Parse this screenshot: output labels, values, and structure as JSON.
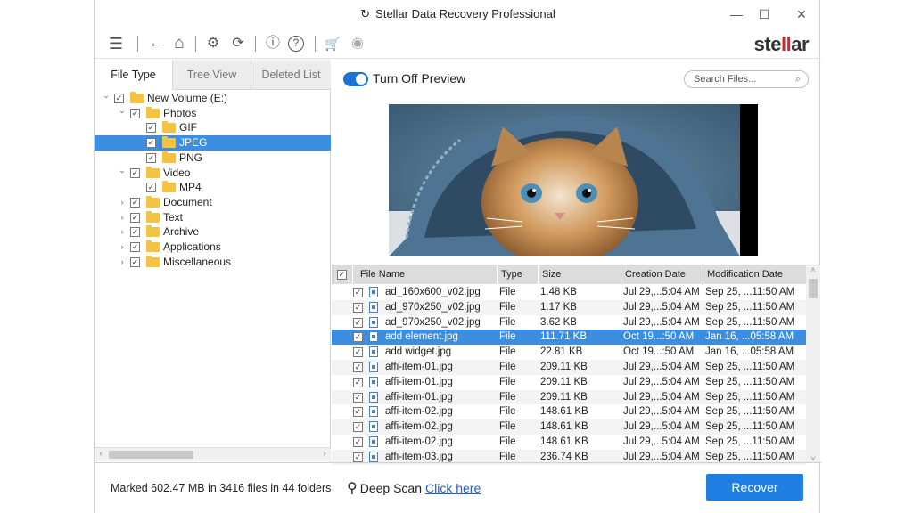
{
  "window": {
    "title": "Stellar Data Recovery Professional",
    "minimize": "—",
    "maximize": "☐",
    "close": "✕"
  },
  "toolbar": {
    "menu_icon": "☰",
    "back_icon": "←",
    "home_icon": "⌂",
    "settings_icon": "⚙",
    "resume_icon": "⟳",
    "info_icon": "ⓘ",
    "help_icon": "?",
    "cart_icon": "🛒",
    "user_icon": "◉",
    "logo_pre": "ste",
    "logo_accent": "ll",
    "logo_post": "ar"
  },
  "tabs": [
    "File Type",
    "Tree View",
    "Deleted List"
  ],
  "tree": [
    {
      "label": "New Volume (E:)",
      "level": 0,
      "arrow": "⌄",
      "selected": false
    },
    {
      "label": "Photos",
      "level": 1,
      "arrow": "⌄",
      "selected": false
    },
    {
      "label": "GIF",
      "level": 2,
      "arrow": "",
      "selected": false
    },
    {
      "label": "JPEG",
      "level": 2,
      "arrow": "",
      "selected": true
    },
    {
      "label": "PNG",
      "level": 2,
      "arrow": "",
      "selected": false
    },
    {
      "label": "Video",
      "level": 1,
      "arrow": "⌄",
      "selected": false
    },
    {
      "label": "MP4",
      "level": 2,
      "arrow": "",
      "selected": false
    },
    {
      "label": "Document",
      "level": 1,
      "arrow": "›",
      "selected": false
    },
    {
      "label": "Text",
      "level": 1,
      "arrow": "›",
      "selected": false
    },
    {
      "label": "Archive",
      "level": 1,
      "arrow": "›",
      "selected": false
    },
    {
      "label": "Applications",
      "level": 1,
      "arrow": "›",
      "selected": false
    },
    {
      "label": "Miscellaneous",
      "level": 1,
      "arrow": "›",
      "selected": false
    }
  ],
  "preview": {
    "toggle_label": "Turn Off Preview",
    "search_placeholder": "Search Files..."
  },
  "file_table": {
    "headers": [
      "File Name",
      "Type",
      "Size",
      "Creation Date",
      "Modification Date"
    ],
    "rows": [
      {
        "name": "ad_160x600_v02.jpg",
        "type": "File",
        "size": "1.48 KB",
        "created": "Jul 29,...5:04 AM",
        "modified": "Sep 25, ...11:50 AM",
        "selected": false
      },
      {
        "name": "ad_970x250_v02.jpg",
        "type": "File",
        "size": "1.17 KB",
        "created": "Jul 29,...5:04 AM",
        "modified": "Sep 25, ...11:50 AM",
        "selected": false
      },
      {
        "name": "ad_970x250_v02.jpg",
        "type": "File",
        "size": "3.62 KB",
        "created": "Jul 29,...5:04 AM",
        "modified": "Sep 25, ...11:50 AM",
        "selected": false
      },
      {
        "name": "add element.jpg",
        "type": "File",
        "size": "111.71 KB",
        "created": "Oct 19...:50 AM",
        "modified": "Jan 16, ...05:58 AM",
        "selected": true
      },
      {
        "name": "add widget.jpg",
        "type": "File",
        "size": "22.81 KB",
        "created": "Oct 19...:50 AM",
        "modified": "Jan 16, ...05:58 AM",
        "selected": false
      },
      {
        "name": "affi-item-01.jpg",
        "type": "File",
        "size": "209.11 KB",
        "created": "Jul 29,...5:04 AM",
        "modified": "Sep 25, ...11:50 AM",
        "selected": false
      },
      {
        "name": "affi-item-01.jpg",
        "type": "File",
        "size": "209.11 KB",
        "created": "Jul 29,...5:04 AM",
        "modified": "Sep 25, ...11:50 AM",
        "selected": false
      },
      {
        "name": "affi-item-01.jpg",
        "type": "File",
        "size": "209.11 KB",
        "created": "Jul 29,...5:04 AM",
        "modified": "Sep 25, ...11:50 AM",
        "selected": false
      },
      {
        "name": "affi-item-02.jpg",
        "type": "File",
        "size": "148.61 KB",
        "created": "Jul 29,...5:04 AM",
        "modified": "Sep 25, ...11:50 AM",
        "selected": false
      },
      {
        "name": "affi-item-02.jpg",
        "type": "File",
        "size": "148.61 KB",
        "created": "Jul 29,...5:04 AM",
        "modified": "Sep 25, ...11:50 AM",
        "selected": false
      },
      {
        "name": "affi-item-02.jpg",
        "type": "File",
        "size": "148.61 KB",
        "created": "Jul 29,...5:04 AM",
        "modified": "Sep 25, ...11:50 AM",
        "selected": false
      },
      {
        "name": "affi-item-03.jpg",
        "type": "File",
        "size": "236.74 KB",
        "created": "Jul 29,...5:04 AM",
        "modified": "Sep 25, ...11:50 AM",
        "selected": false
      }
    ]
  },
  "status": {
    "marked": "Marked 602.47 MB in 3416 files in 44 folders",
    "deep_scan_label": "Deep Scan",
    "deep_scan_link": "Click here",
    "recover_label": "Recover"
  },
  "colors": {
    "accent": "#1f7fe0",
    "selection": "#3c8fe0",
    "folder": "#f5c344",
    "logo_accent": "#d9232a"
  }
}
